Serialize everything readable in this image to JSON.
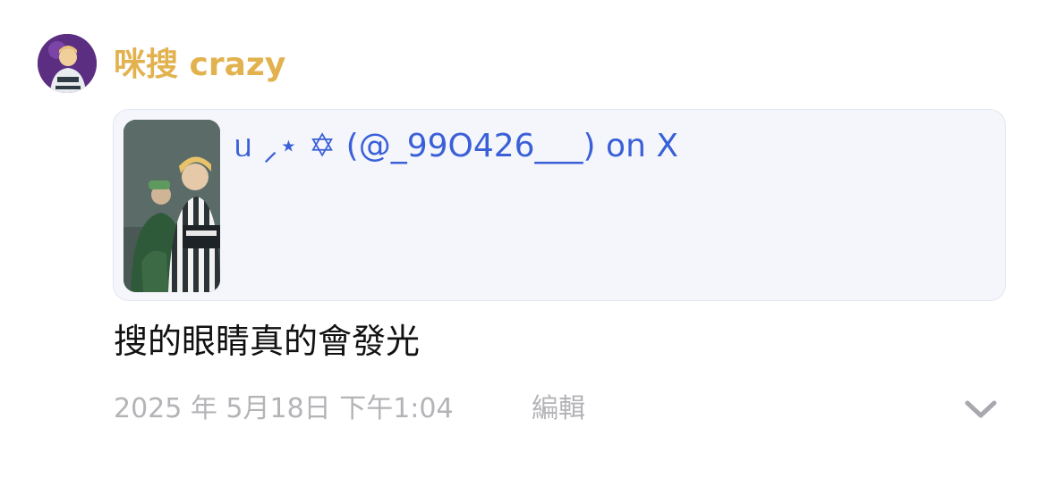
{
  "message": {
    "author": "咪搜 crazy",
    "link_preview": {
      "title": "ᥙ ⸝⋆ ✡︎ (@_99O426___) on X"
    },
    "text": "搜的眼睛真的會發光",
    "timestamp": "2025 年 5月18日 下午1:04",
    "edit_label": "編輯"
  },
  "icons": {
    "avatar": "profile-photo",
    "thumbnail": "tweet-photo",
    "expand": "chevron-down-icon"
  },
  "colors": {
    "author": "#e2b24f",
    "link": "#3a60d8",
    "meta": "#b4b4b8",
    "card_bg": "#f5f6fb"
  }
}
